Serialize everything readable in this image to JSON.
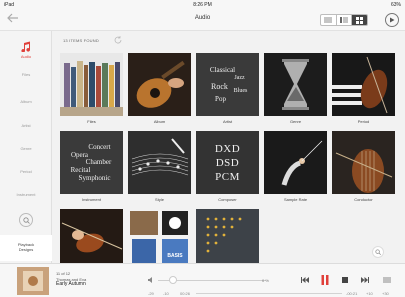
{
  "status_bar": {
    "left": "iPad",
    "time": "8:26 PM",
    "right": "63%"
  },
  "nav": {
    "title": "Audio",
    "back_icon": "back-arrow-icon"
  },
  "sidebar": {
    "items": [
      {
        "label": "Audio",
        "icon": "music-note-icon",
        "active": true
      },
      {
        "label": "Files"
      },
      {
        "label": "Album"
      },
      {
        "label": "Artist"
      },
      {
        "label": "Genre"
      },
      {
        "label": "Period"
      },
      {
        "label": "Instrument"
      }
    ],
    "playback_label_1": "Playback",
    "playback_label_2": "Designs"
  },
  "content": {
    "items_found": "13 ITEMS FOUND",
    "tiles": [
      {
        "label": "Files",
        "art": "books-photo"
      },
      {
        "label": "Album",
        "art": "guitar-photo"
      },
      {
        "label": "Artist",
        "art": "genre-words",
        "words": [
          "Classical",
          "Jazz",
          "Rock",
          "Blues",
          "Pop"
        ]
      },
      {
        "label": "Genre",
        "art": "hourglass-photo"
      },
      {
        "label": "Period",
        "art": "violin-piano-photo"
      },
      {
        "label": "Instrument",
        "art": "instrument-words",
        "words": [
          "Concert",
          "Opera",
          "Chamber",
          "Recital",
          "Symphonic"
        ]
      },
      {
        "label": "Style",
        "art": "sheet-music-photo"
      },
      {
        "label": "Composer",
        "art": "format-words",
        "words": [
          "DXD",
          "DSD",
          "PCM"
        ]
      },
      {
        "label": "Sample Rate",
        "art": "conductor-photo"
      },
      {
        "label": "Conductor",
        "art": "cello-photo"
      },
      {
        "label": "",
        "art": "violinist-photo"
      },
      {
        "label": "",
        "art": "labels-photo",
        "logo_text": "BASIS"
      },
      {
        "label": "",
        "art": "stars-grid"
      }
    ]
  },
  "player": {
    "track_num": "11 of 12",
    "artist": "Thomas and Eva",
    "title": "Early Autumn",
    "volume_pct": "0 %",
    "volume_level": 0.1,
    "progress_level": 0.0,
    "elapsed": "00:26",
    "remaining": "-00:21",
    "extra_1": "-29",
    "extra_2": "-10",
    "extra_3": "+10",
    "extra_4": "+30",
    "accent": "#e0403a"
  }
}
